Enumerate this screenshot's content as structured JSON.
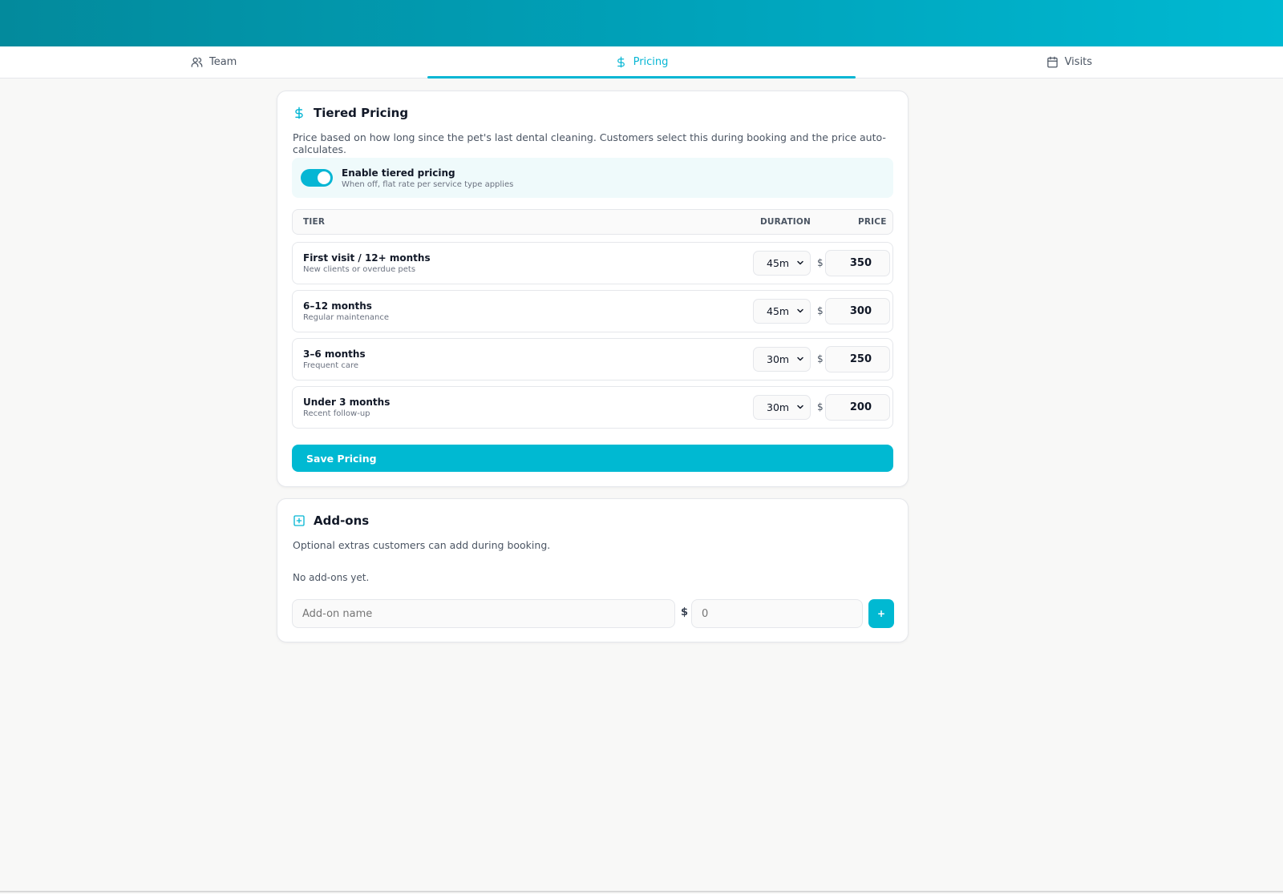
{
  "tabs": [
    {
      "label": "Team",
      "icon": "users-icon"
    },
    {
      "label": "Pricing",
      "icon": "dollar-icon",
      "active": true
    },
    {
      "label": "Visits",
      "icon": "calendar-icon"
    }
  ],
  "pricing": {
    "title": "Tiered Pricing",
    "description": "Price based on how long since the pet's last dental cleaning. Customers select this during booking and the price auto-calculates.",
    "toggle": {
      "label": "Enable tiered pricing",
      "sublabel": "When off, flat rate per service type applies",
      "enabled": true
    },
    "columns": {
      "tier": "TIER",
      "duration": "DURATION",
      "price": "PRICE"
    },
    "currency_symbol": "$",
    "tiers": [
      {
        "name": "First visit / 12+ months",
        "sub": "New clients or overdue pets",
        "duration": "45m",
        "price": "350"
      },
      {
        "name": "6–12 months",
        "sub": "Regular maintenance",
        "duration": "45m",
        "price": "300"
      },
      {
        "name": "3–6 months",
        "sub": "Frequent care",
        "duration": "30m",
        "price": "250"
      },
      {
        "name": "Under 3 months",
        "sub": "Recent follow-up",
        "duration": "30m",
        "price": "200"
      }
    ],
    "save_label": "Save Pricing"
  },
  "addons": {
    "title": "Add-ons",
    "description": "Optional extras customers can add during booking.",
    "empty": "No add-ons yet.",
    "name_placeholder": "Add-on name",
    "price_placeholder": "0",
    "currency_symbol": "$",
    "add_label": "+"
  },
  "colors": {
    "accent": "#06b6d4",
    "header_start": "#038a9c",
    "header_end": "#00b9d2"
  }
}
